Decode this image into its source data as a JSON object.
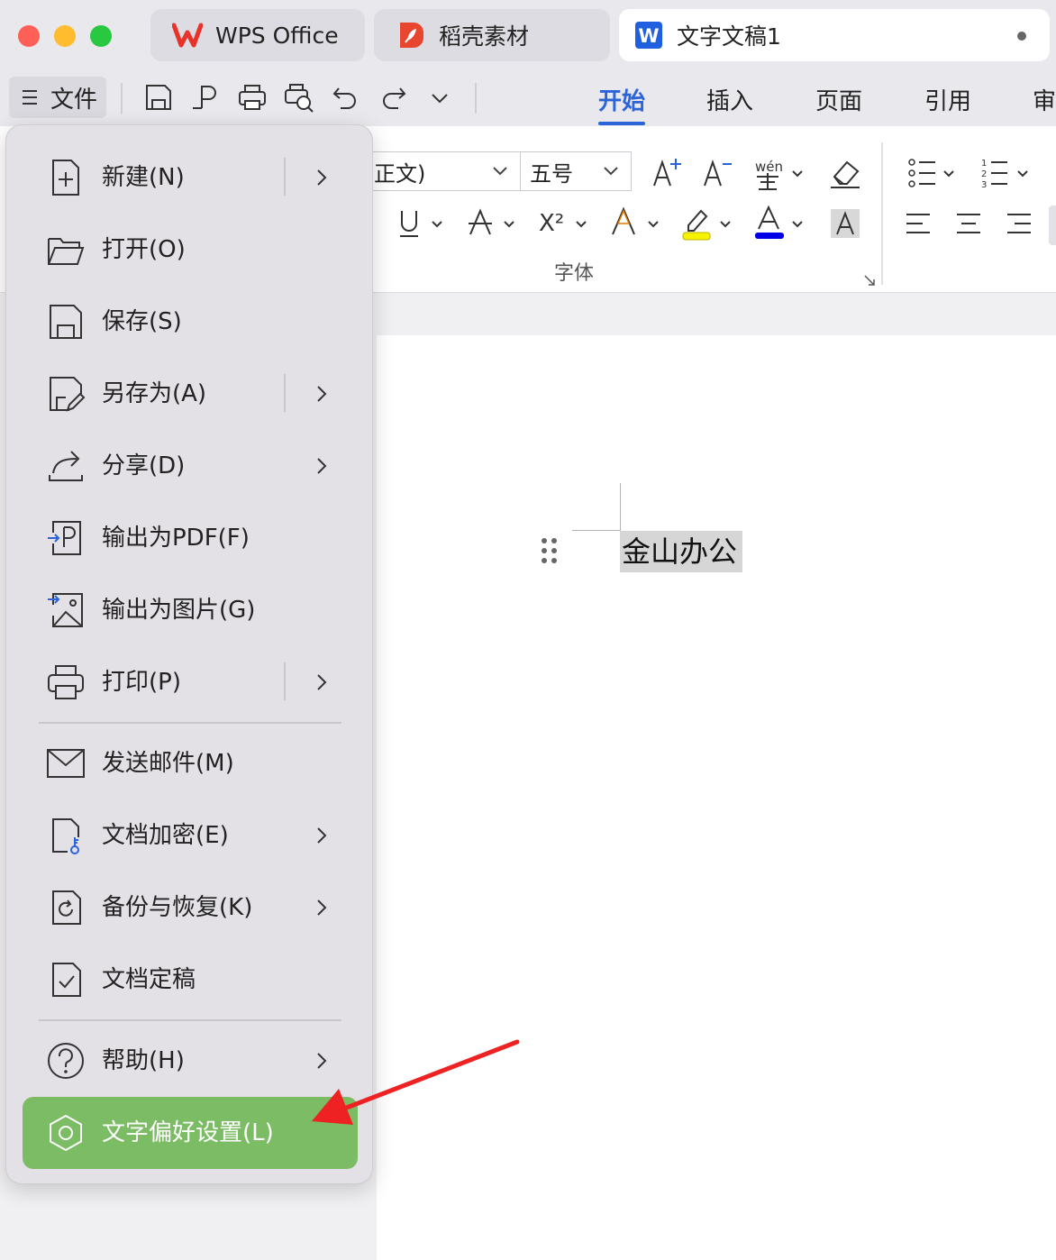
{
  "tabs": [
    {
      "label": "WPS Office"
    },
    {
      "label": "稻壳素材"
    },
    {
      "label": "文字文稿1"
    }
  ],
  "toolbar": {
    "file_label": "文件",
    "ribbon_tabs": [
      "开始",
      "插入",
      "页面",
      "引用",
      "审"
    ]
  },
  "ribbon": {
    "font_name": "正文)",
    "font_size": "五号",
    "group_label": "字体",
    "superscript_label": "X²"
  },
  "document": {
    "text": "金山办公"
  },
  "file_menu": {
    "items": [
      {
        "label": "新建(N)"
      },
      {
        "label": "打开(O)"
      },
      {
        "label": "保存(S)"
      },
      {
        "label": "另存为(A)"
      },
      {
        "label": "分享(D)"
      },
      {
        "label": "输出为PDF(F)"
      },
      {
        "label": "输出为图片(G)"
      },
      {
        "label": "打印(P)"
      },
      {
        "label": "发送邮件(M)"
      },
      {
        "label": "文档加密(E)"
      },
      {
        "label": "备份与恢复(K)"
      },
      {
        "label": "文档定稿"
      },
      {
        "label": "帮助(H)"
      },
      {
        "label": "文字偏好设置(L)"
      }
    ]
  },
  "colors": {
    "accent": "#2b63d9",
    "selected_item": "#7bbc64",
    "highlight_yellow": "#f7f200",
    "font_color_blue": "#0000e6",
    "annotation_arrow": "#ee2222"
  }
}
